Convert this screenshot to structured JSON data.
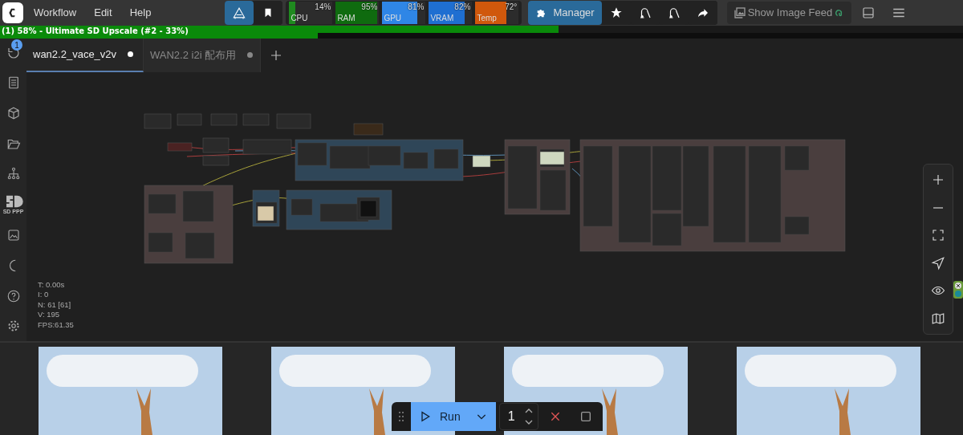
{
  "menu": [
    "Workflow",
    "Edit",
    "Help"
  ],
  "monitors": [
    {
      "label": "CPU",
      "reading": "14%",
      "level": 0.14,
      "color": "#1f8a1f"
    },
    {
      "label": "RAM",
      "reading": "95%",
      "level": 0.95,
      "color": "#0f6b0f"
    },
    {
      "label": "GPU",
      "reading": "81%",
      "level": 0.81,
      "color": "#2f86e6"
    },
    {
      "label": "VRAM",
      "reading": "82%",
      "level": 0.82,
      "color": "#1f6fd1"
    },
    {
      "label": "Temp",
      "reading": "72°",
      "level": 0.72,
      "color": "#d0580c"
    }
  ],
  "manager": {
    "label": "Manager"
  },
  "image_feed": {
    "label": "Show Image Feed"
  },
  "progress": {
    "text": "(1) 58% - Ultimate SD Upscale (#2 - 33%)",
    "level": 0.58
  },
  "node_progress": {
    "level": 0.33
  },
  "queue_badge": "1",
  "tabs": [
    {
      "label": "wan2.2_vace_v2v",
      "selected": true,
      "modified": true
    },
    {
      "label": "WAN2.2 i2i 配布用",
      "selected": false,
      "modified": true
    }
  ],
  "sidebar_logo_text": "SD PPP",
  "stats": [
    "T: 0.00s",
    "I: 0",
    "N: 61 [61]",
    "V: 195",
    "FPS:61.35"
  ],
  "run": {
    "label": "Run",
    "count": "1"
  }
}
